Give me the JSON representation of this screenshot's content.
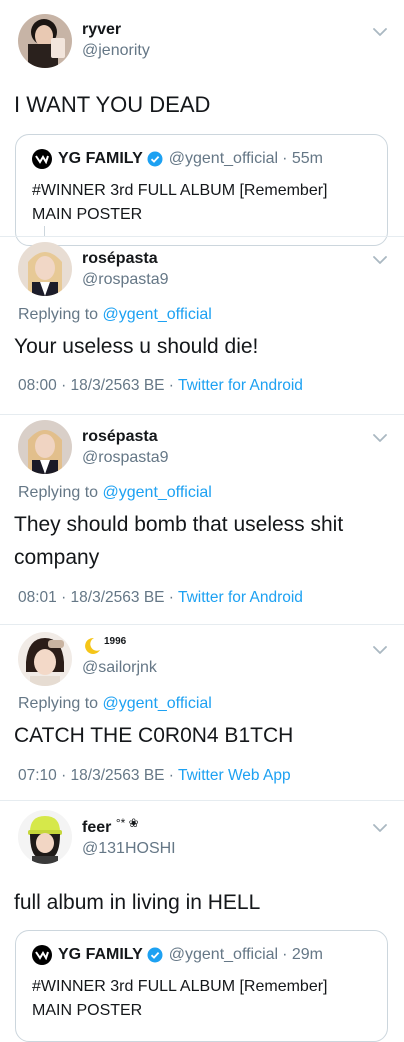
{
  "tweets": [
    {
      "name": "ryver",
      "handle": "@jenority",
      "text": "I WANT YOU DEAD",
      "quote": {
        "name": "YG FAMILY",
        "handle": "@ygent_official",
        "time": "· 55m",
        "line1": "#WINNER 3rd FULL ALBUM [Remember]",
        "line2": "MAIN POSTER"
      }
    },
    {
      "name": "rosépasta",
      "handle": "@rospasta9",
      "replying_prefix": "Replying to ",
      "replying_to": "@ygent_official",
      "text": "Your useless u should die!",
      "meta_time": "08:00 · 18/3/2563 BE · ",
      "meta_source": "Twitter for Android"
    },
    {
      "name": "rosépasta",
      "handle": "@rospasta9",
      "replying_prefix": "Replying to ",
      "replying_to": "@ygent_official",
      "text": "They should bomb that useless shit company",
      "meta_time": "08:01 · 18/3/2563 BE · ",
      "meta_source": "Twitter for Android"
    },
    {
      "name": "1996",
      "handle": "@sailorjnk",
      "replying_prefix": "Replying to ",
      "replying_to": "@ygent_official",
      "text": "CATCH THE C0R0N4 B1TCH",
      "meta_time": "07:10 · 18/3/2563 BE · ",
      "meta_source": "Twitter Web App"
    },
    {
      "name": "feer",
      "name_suffix": "°* ❀",
      "handle": "@131HOSHI",
      "text": "full album in living in HELL",
      "quote": {
        "name": "YG FAMILY",
        "handle": "@ygent_official",
        "time": "· 29m",
        "line1": "#WINNER 3rd FULL ALBUM [Remember]",
        "line2": "MAIN POSTER"
      }
    }
  ],
  "colors": {
    "link": "#1da1f2",
    "secondary": "#657786",
    "text": "#14171a",
    "border": "#ccd6dd",
    "verified": "#1da1f2"
  },
  "icons": {
    "chevron": "chevron-down-icon",
    "verified": "verified-badge-icon",
    "yg_logo": "yg-logo-icon",
    "moon": "crescent-moon-icon"
  }
}
